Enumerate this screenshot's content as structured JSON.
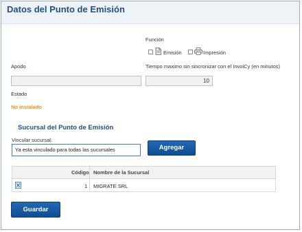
{
  "header": {
    "title": "Datos del Punto de Emisión"
  },
  "funcion": {
    "label": "Función",
    "options": [
      {
        "label": "Emisión",
        "checked": false,
        "icon": "document-icon"
      },
      {
        "label": "Impresión",
        "checked": false,
        "icon": "printer-icon"
      }
    ]
  },
  "apodo": {
    "label": "Apodo",
    "value": ""
  },
  "tiempo": {
    "label": "Tiempo maximo sin sincronizar con el InvoiCy (en minutos)",
    "value": "10"
  },
  "estado": {
    "label": "Estado",
    "value": "No instalado"
  },
  "sucursal": {
    "title": "Sucursal del Punto de Emisión",
    "vincular_label": "Vincular sucursal:",
    "vincular_value": "Ya esta vinculado para todas las sucursales",
    "add_button": "Agregar",
    "table": {
      "headers": [
        "Código",
        "Nombre de la Sucursal"
      ],
      "rows": [
        {
          "codigo": "1",
          "nombre": "MIGRATE SRL"
        }
      ]
    }
  },
  "save_button": "Guardar"
}
